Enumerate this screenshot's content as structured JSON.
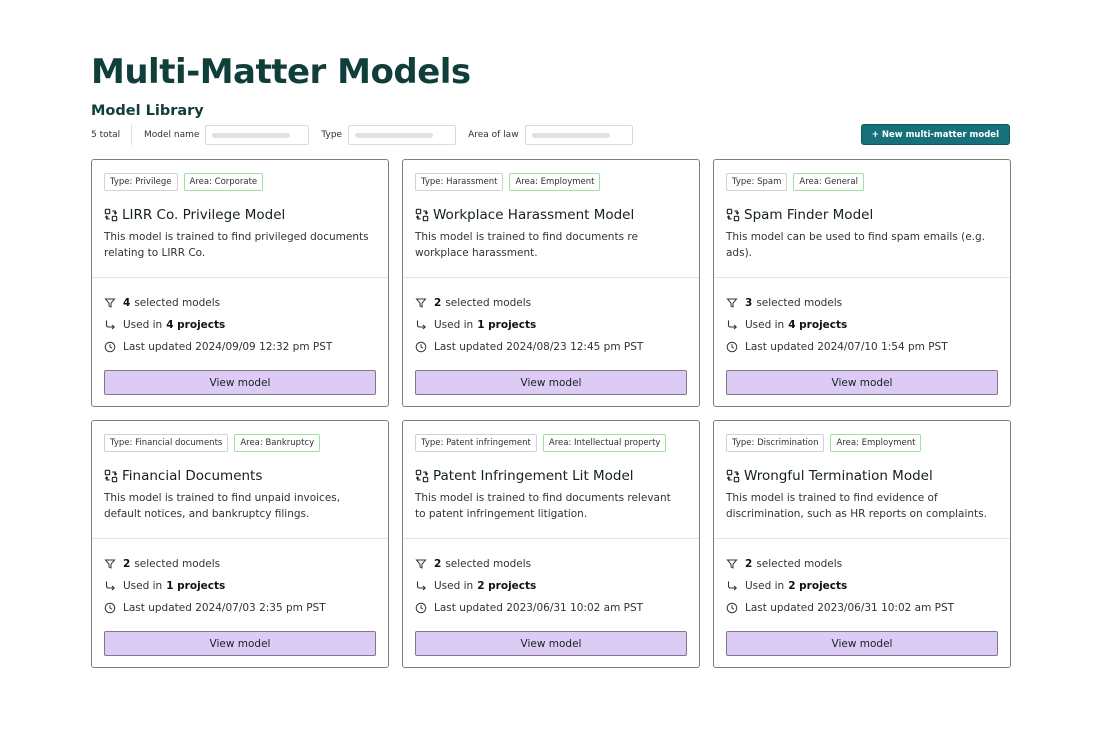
{
  "page": {
    "title": "Multi-Matter Models",
    "section_title": "Model Library"
  },
  "toolbar": {
    "total": "5 total",
    "filters": [
      {
        "label": "Model name",
        "value": ""
      },
      {
        "label": "Type",
        "value": ""
      },
      {
        "label": "Area of law",
        "value": ""
      }
    ],
    "new_button_label": "+ New multi-matter model"
  },
  "colors": {
    "brand": "#0f3e3b",
    "primary_button": "#17717a",
    "view_button": "#dccbf5",
    "area_tag_border": "#9fe0a3"
  },
  "models": [
    {
      "type_tag": "Type: Privilege",
      "area_tag": "Area: Corporate",
      "name": "LIRR Co. Privilege Model",
      "description": "This model is trained to find privileged documents relating to LIRR Co.",
      "selected_count": "4",
      "selected_label": "selected models",
      "used_prefix": "Used in",
      "used_value": "4 projects",
      "updated": "Last updated 2024/09/09 12:32 pm PST",
      "button_label": "View model"
    },
    {
      "type_tag": "Type: Harassment",
      "area_tag": "Area: Employment",
      "name": "Workplace Harassment Model",
      "description": "This model is trained to find documents re workplace harassment.",
      "selected_count": "2",
      "selected_label": "selected models",
      "used_prefix": "Used in",
      "used_value": "1 projects",
      "updated": "Last updated 2024/08/23 12:45 pm PST",
      "button_label": "View model"
    },
    {
      "type_tag": "Type: Spam",
      "area_tag": "Area: General",
      "name": "Spam Finder Model",
      "description": "This model can be used to find spam emails (e.g. ads).",
      "selected_count": "3",
      "selected_label": "selected models",
      "used_prefix": "Used in",
      "used_value": "4 projects",
      "updated": "Last updated 2024/07/10 1:54 pm PST",
      "button_label": "View model"
    },
    {
      "type_tag": "Type: Financial documents",
      "area_tag": "Area: Bankruptcy",
      "name": "Financial Documents",
      "description": "This model is trained to find unpaid invoices, default notices, and bankruptcy filings.",
      "selected_count": "2",
      "selected_label": "selected models",
      "used_prefix": "Used in",
      "used_value": "1 projects",
      "updated": "Last updated 2024/07/03 2:35 pm PST",
      "button_label": "View model"
    },
    {
      "type_tag": "Type: Patent infringement",
      "area_tag": "Area: Intellectual property",
      "name": "Patent Infringement Lit Model",
      "description": "This model is trained to find documents relevant to patent infringement litigation.",
      "selected_count": "2",
      "selected_label": "selected models",
      "used_prefix": "Used in",
      "used_value": "2 projects",
      "updated": "Last updated 2023/06/31 10:02 am PST",
      "button_label": "View model"
    },
    {
      "type_tag": "Type: Discrimination",
      "area_tag": "Area: Employment",
      "name": "Wrongful Termination Model",
      "description": "This model is trained to find evidence of discrimination, such as HR reports on complaints.",
      "selected_count": "2",
      "selected_label": "selected models",
      "used_prefix": "Used in",
      "used_value": "2 projects",
      "updated": "Last updated 2023/06/31 10:02 am PST",
      "button_label": "View model"
    }
  ]
}
